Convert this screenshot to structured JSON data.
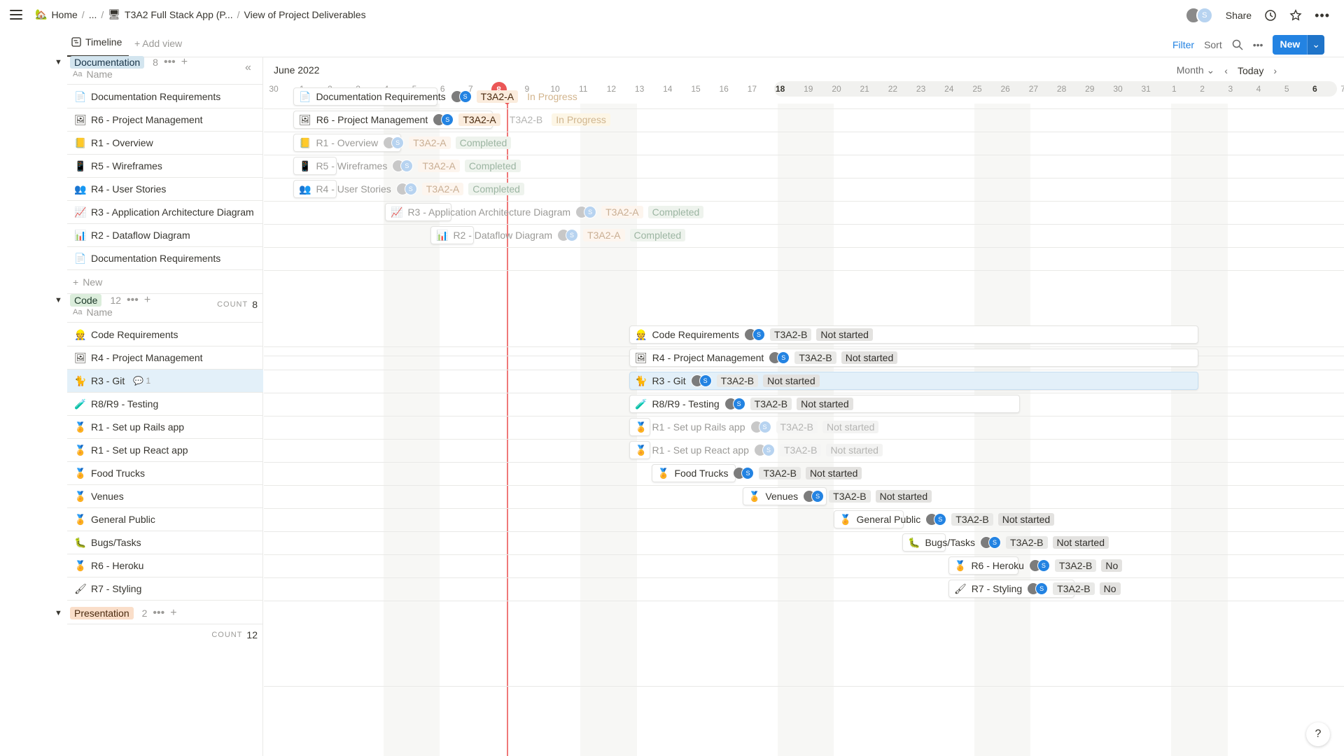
{
  "breadcrumb": {
    "home": "Home",
    "ellipsis": "...",
    "app": "T3A2 Full Stack App (P...",
    "view": "View of Project Deliverables",
    "home_icon": "house-icon",
    "app_icon": "monitor-icon"
  },
  "topbar": {
    "share": "Share",
    "avatar_letter": "S"
  },
  "viewbar": {
    "tab": "Timeline",
    "add_view": "Add view",
    "filter": "Filter",
    "sort": "Sort",
    "new": "New"
  },
  "timeline_header": {
    "month": "June 2022",
    "scale": "Month",
    "today": "Today",
    "days": [
      "30",
      "1",
      "2",
      "3",
      "4",
      "5",
      "6",
      "7",
      "8",
      "9",
      "10",
      "11",
      "12",
      "13",
      "14",
      "15",
      "16",
      "17",
      "18",
      "19",
      "20",
      "21",
      "22",
      "23",
      "24",
      "25",
      "26",
      "27",
      "28",
      "29",
      "30",
      "31",
      "1",
      "2",
      "3",
      "4",
      "5",
      "6",
      "7"
    ],
    "today_day": "8"
  },
  "name_column": "Name",
  "new_label": "New",
  "count_label": "COUNT",
  "groups": [
    {
      "tag": "Documentation",
      "count": "8",
      "items": [
        {
          "icon": "📄",
          "name": "Documentation Requirements",
          "team": "T3A2-A",
          "status": "In Progress"
        },
        {
          "icon": "🖼",
          "name": "R6 - Project Management",
          "team": "T3A2-A",
          "team2": "T3A2-B",
          "status": "In Progress"
        },
        {
          "icon": "📒",
          "name": "R1 - Overview",
          "team": "T3A2-A",
          "status": "Completed"
        },
        {
          "icon": "📱",
          "name": "R5 - Wireframes",
          "team": "T3A2-A",
          "status": "Completed"
        },
        {
          "icon": "👥",
          "name": "R4 - User Stories",
          "team": "T3A2-A",
          "status": "Completed"
        },
        {
          "icon": "📈",
          "name": "R3 - Application Architecture Diagram",
          "team": "T3A2-A",
          "status": "Completed"
        },
        {
          "icon": "📊",
          "name": "R2 - Dataflow Diagram",
          "team": "T3A2-A",
          "status": "Completed"
        },
        {
          "icon": "📄",
          "name": "Documentation Requirements"
        }
      ]
    },
    {
      "tag": "Code",
      "count": "12",
      "items": [
        {
          "icon": "👷",
          "name": "Code Requirements",
          "team": "T3A2-B",
          "status": "Not started"
        },
        {
          "icon": "🖼",
          "name": "R4 - Project Management",
          "team": "T3A2-B",
          "status": "Not started"
        },
        {
          "icon": "🐈",
          "name": "R3 - Git",
          "comments": "1",
          "team": "T3A2-B",
          "status": "Not started"
        },
        {
          "icon": "🧪",
          "name": "R8/R9 - Testing",
          "team": "T3A2-B",
          "status": "Not started"
        },
        {
          "icon": "🏅",
          "name": "R1 - Set up Rails app",
          "team": "T3A2-B",
          "status": "Not started"
        },
        {
          "icon": "🏅",
          "name": "R1 - Set up React app",
          "team": "T3A2-B",
          "status": "Not started"
        },
        {
          "icon": "🏅",
          "name": "Food Trucks",
          "team": "T3A2-B",
          "status": "Not started"
        },
        {
          "icon": "🏅",
          "name": "Venues",
          "team": "T3A2-B",
          "status": "Not started"
        },
        {
          "icon": "🏅",
          "name": "General Public",
          "team": "T3A2-B",
          "status": "Not started"
        },
        {
          "icon": "🐛",
          "name": "Bugs/Tasks",
          "team": "T3A2-B",
          "status": "Not started"
        },
        {
          "icon": "🏅",
          "name": "R6 - Heroku",
          "team": "T3A2-B",
          "status": "No"
        },
        {
          "icon": "🖌",
          "name": "R7 - Styling",
          "team": "T3A2-B",
          "status": "No"
        }
      ]
    },
    {
      "tag": "Presentation",
      "count": "2",
      "items": []
    }
  ],
  "colors": {
    "accent": "#2383e2",
    "today": "#eb5757",
    "documentation_tag": "#d3e5ef",
    "code_tag": "#dbeddb",
    "presentation_tag": "#fadec9"
  }
}
